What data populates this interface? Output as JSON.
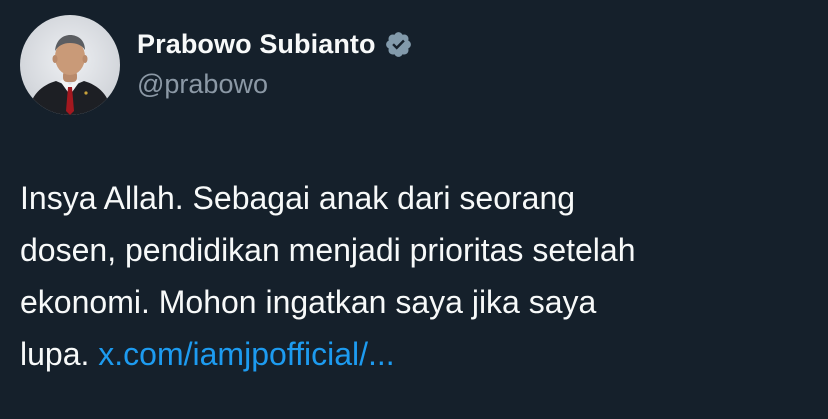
{
  "author": {
    "display_name": "Prabowo Subianto",
    "handle": "@prabowo",
    "verified_icon": "verified-badge-icon",
    "avatar_icon": "profile-photo"
  },
  "tweet": {
    "lines": [
      "Insya Allah. Sebagai anak dari seorang",
      "dosen, pendidikan menjadi prioritas setelah",
      "ekonomi. Mohon ingatkan saya jika saya"
    ],
    "last_line_text": "lupa. ",
    "link_text": "x.com/iamjpofficial/..."
  },
  "colors": {
    "background": "#15202b",
    "text": "#f7f9f9",
    "secondary_text": "#8b98a5",
    "link": "#1d9bf0"
  }
}
